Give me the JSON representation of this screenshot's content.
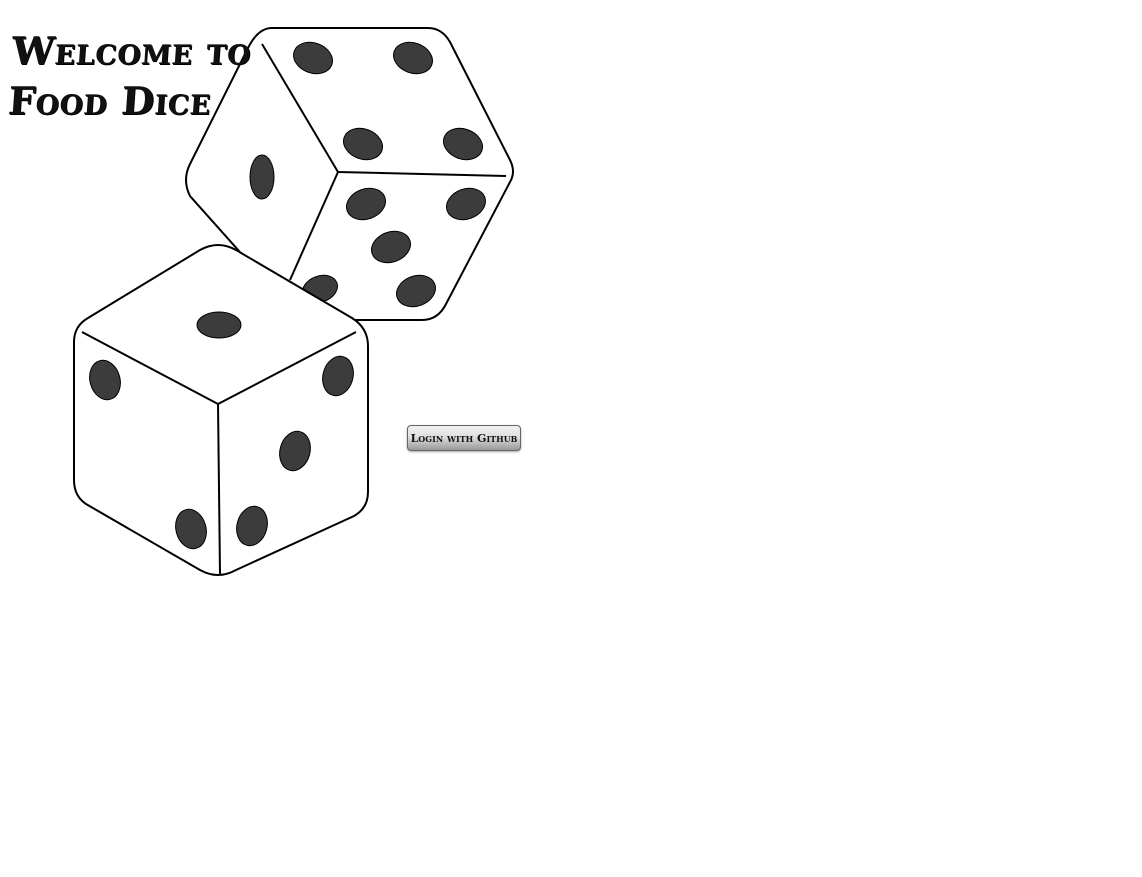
{
  "header": {
    "title_line1": "Welcome to",
    "title_line2": "Food Dice"
  },
  "auth": {
    "login_label": "Login with Github"
  },
  "illustration": {
    "icon": "dice-icon",
    "pip_color": "#3c3c3c",
    "outline_color": "#000000",
    "face_color": "#ffffff"
  }
}
